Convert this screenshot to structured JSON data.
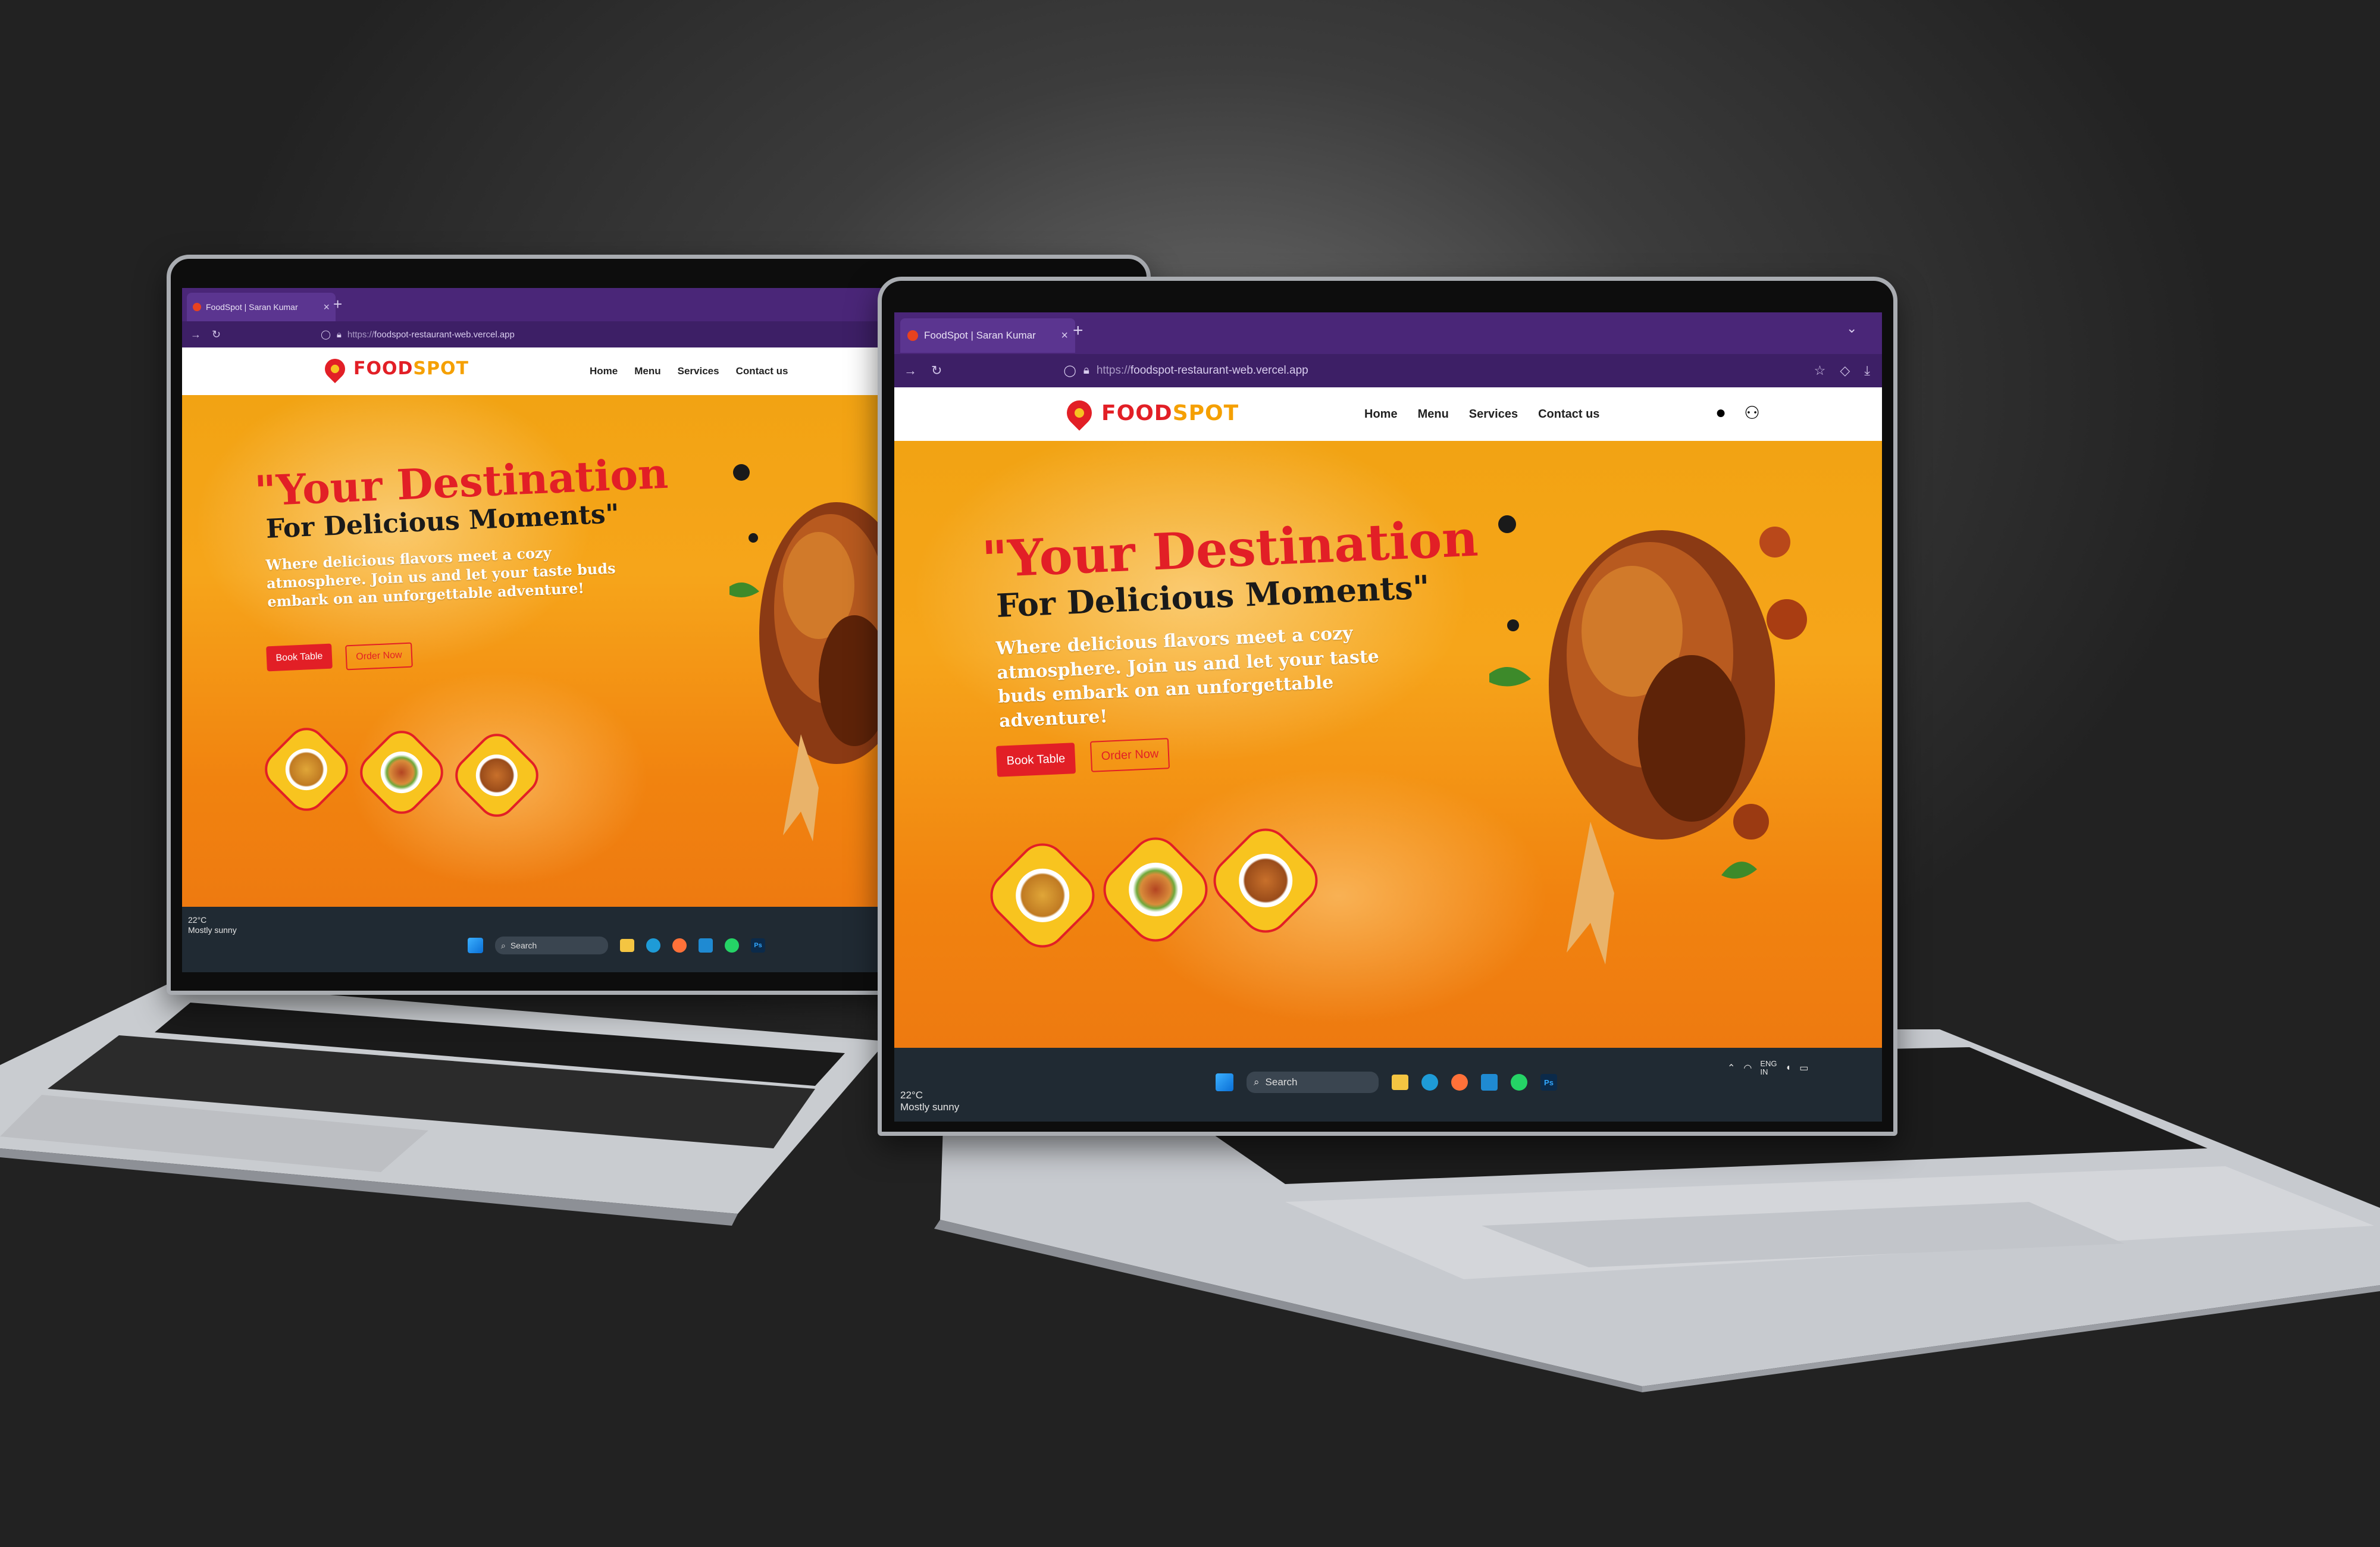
{
  "browser": {
    "tab_title": "FoodSpot | Saran Kumar",
    "new_tab": "+",
    "tab_close": "×",
    "url_scheme": "https://",
    "url_host": "foodspot-restaurant-web.vercel.app"
  },
  "site": {
    "logo_part1": "FOOD",
    "logo_part2": "SPOT",
    "nav": [
      "Home",
      "Menu",
      "Services",
      "Contact us"
    ],
    "hero_title": "\"Your Destination",
    "hero_subtitle": "For Delicious Moments\"",
    "hero_desc": "Where delicious flavors meet a cozy atmosphere. Join us and let your taste buds embark on an unforgettable adventure!",
    "btn_primary": "Book Table",
    "btn_secondary": "Order Now"
  },
  "taskbar": {
    "temperature": "22°C",
    "weather": "Mostly sunny",
    "search": "Search",
    "lang": "ENG",
    "region": "IN"
  },
  "colors": {
    "brand_red": "#e21f26",
    "brand_yellow": "#f7c321",
    "browser_purple": "#4a2678"
  },
  "icons": [
    "windows-start-icon",
    "search-icon",
    "file-explorer-icon",
    "edge-icon",
    "firefox-icon",
    "vscode-icon",
    "whatsapp-icon",
    "photoshop-icon",
    "wifi-icon",
    "volume-icon",
    "battery-icon",
    "refresh-icon",
    "back-icon",
    "lock-icon",
    "shield-icon",
    "star-icon",
    "download-icon",
    "github-icon",
    "users-icon"
  ]
}
